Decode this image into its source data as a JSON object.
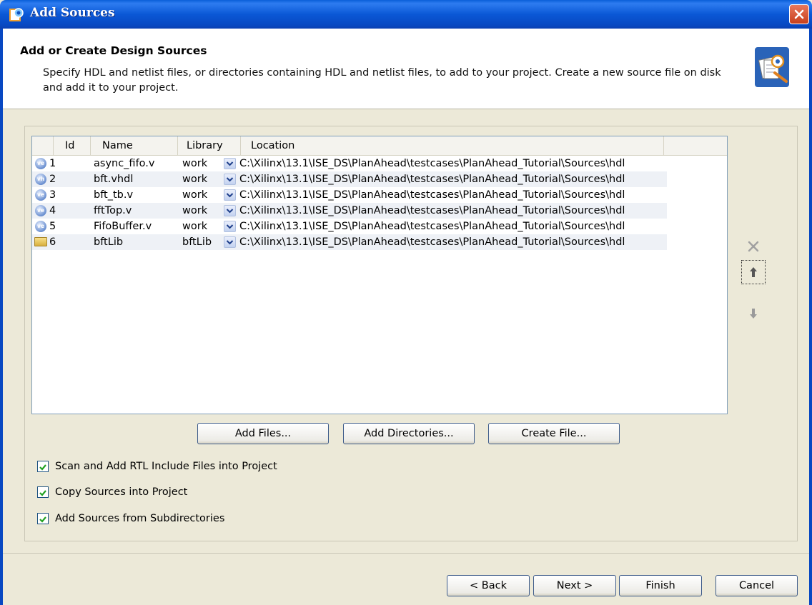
{
  "window": {
    "title": "Add Sources",
    "close_icon": "close-icon"
  },
  "header": {
    "title": "Add or Create Design Sources",
    "description": "Specify HDL and netlist files, or directories containing HDL and netlist files, to add to your project. Create a new source file on disk and add it to your project."
  },
  "table": {
    "columns": {
      "id": "Id",
      "name": "Name",
      "library": "Library",
      "location": "Location"
    },
    "rows": [
      {
        "icon": "ve",
        "id": "1",
        "name": "async_fifo.v",
        "library": "work",
        "location": "C:\\Xilinx\\13.1\\ISE_DS\\PlanAhead\\testcases\\PlanAhead_Tutorial\\Sources\\hdl"
      },
      {
        "icon": "vh",
        "id": "2",
        "name": "bft.vhdl",
        "library": "work",
        "location": "C:\\Xilinx\\13.1\\ISE_DS\\PlanAhead\\testcases\\PlanAhead_Tutorial\\Sources\\hdl"
      },
      {
        "icon": "ve",
        "id": "3",
        "name": "bft_tb.v",
        "library": "work",
        "location": "C:\\Xilinx\\13.1\\ISE_DS\\PlanAhead\\testcases\\PlanAhead_Tutorial\\Sources\\hdl"
      },
      {
        "icon": "ve",
        "id": "4",
        "name": "fftTop.v",
        "library": "work",
        "location": "C:\\Xilinx\\13.1\\ISE_DS\\PlanAhead\\testcases\\PlanAhead_Tutorial\\Sources\\hdl"
      },
      {
        "icon": "ve",
        "id": "5",
        "name": "FifoBuffer.v",
        "library": "work",
        "location": "C:\\Xilinx\\13.1\\ISE_DS\\PlanAhead\\testcases\\PlanAhead_Tutorial\\Sources\\hdl"
      },
      {
        "icon": "folder",
        "id": "6",
        "name": "bftLib",
        "library": "bftLib",
        "location": "C:\\Xilinx\\13.1\\ISE_DS\\PlanAhead\\testcases\\PlanAhead_Tutorial\\Sources\\hdl"
      }
    ]
  },
  "actions": {
    "add_files": "Add Files...",
    "add_directories": "Add Directories...",
    "create_file": "Create File..."
  },
  "options": {
    "scan_rtl": "Scan and Add RTL Include Files into Project",
    "copy_sources": "Copy Sources into Project",
    "add_subdirs": "Add Sources from Subdirectories"
  },
  "footer": {
    "back": "< Back",
    "next": "Next >",
    "finish": "Finish",
    "cancel": "Cancel"
  }
}
